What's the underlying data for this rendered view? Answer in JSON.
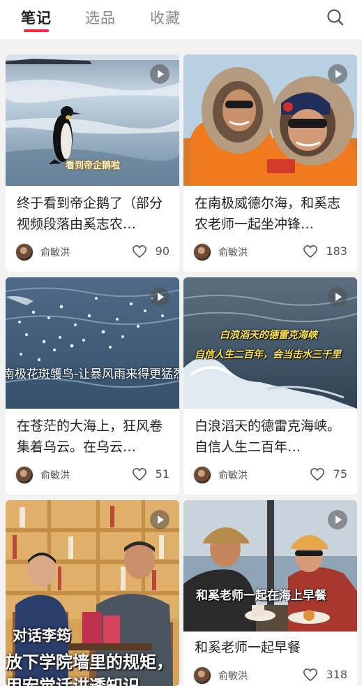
{
  "tabs": [
    {
      "label": "笔记"
    },
    {
      "label": "选品"
    },
    {
      "label": "收藏"
    }
  ],
  "notes": [
    {
      "title": "终于看到帝企鹅了（部分视频段落由奚志农…",
      "author": "俞敏洪",
      "likes": "90",
      "thumb_text": "看到帝企鹅啦"
    },
    {
      "title": "在南极威德尔海，和奚志农老师一起坐冲锋…",
      "author": "俞敏洪",
      "likes": "183"
    },
    {
      "title": "在苍茫的大海上，狂风卷集着乌云。在乌云…",
      "author": "俞敏洪",
      "likes": "51",
      "thumb_text": "南极花斑鹱鸟-让暴风雨来得更猛烈"
    },
    {
      "title": "白浪滔天的德雷克海峡。自信人生二百年…",
      "author": "俞敏洪",
      "likes": "75",
      "thumb_text_1": "白浪滔天的德雷克海峡",
      "thumb_text_2": "自信人生二百年，会当击水三千里"
    },
    {
      "thumb_text_1": "对话李筠",
      "thumb_text_2": "放下学院墙里的规矩，",
      "thumb_text_3": "用宏觉话讲透知识"
    },
    {
      "title": "和奚老师一起早餐",
      "author": "俞敏洪",
      "likes": "318",
      "thumb_text": "和奚老师一起在海上早餐"
    }
  ]
}
